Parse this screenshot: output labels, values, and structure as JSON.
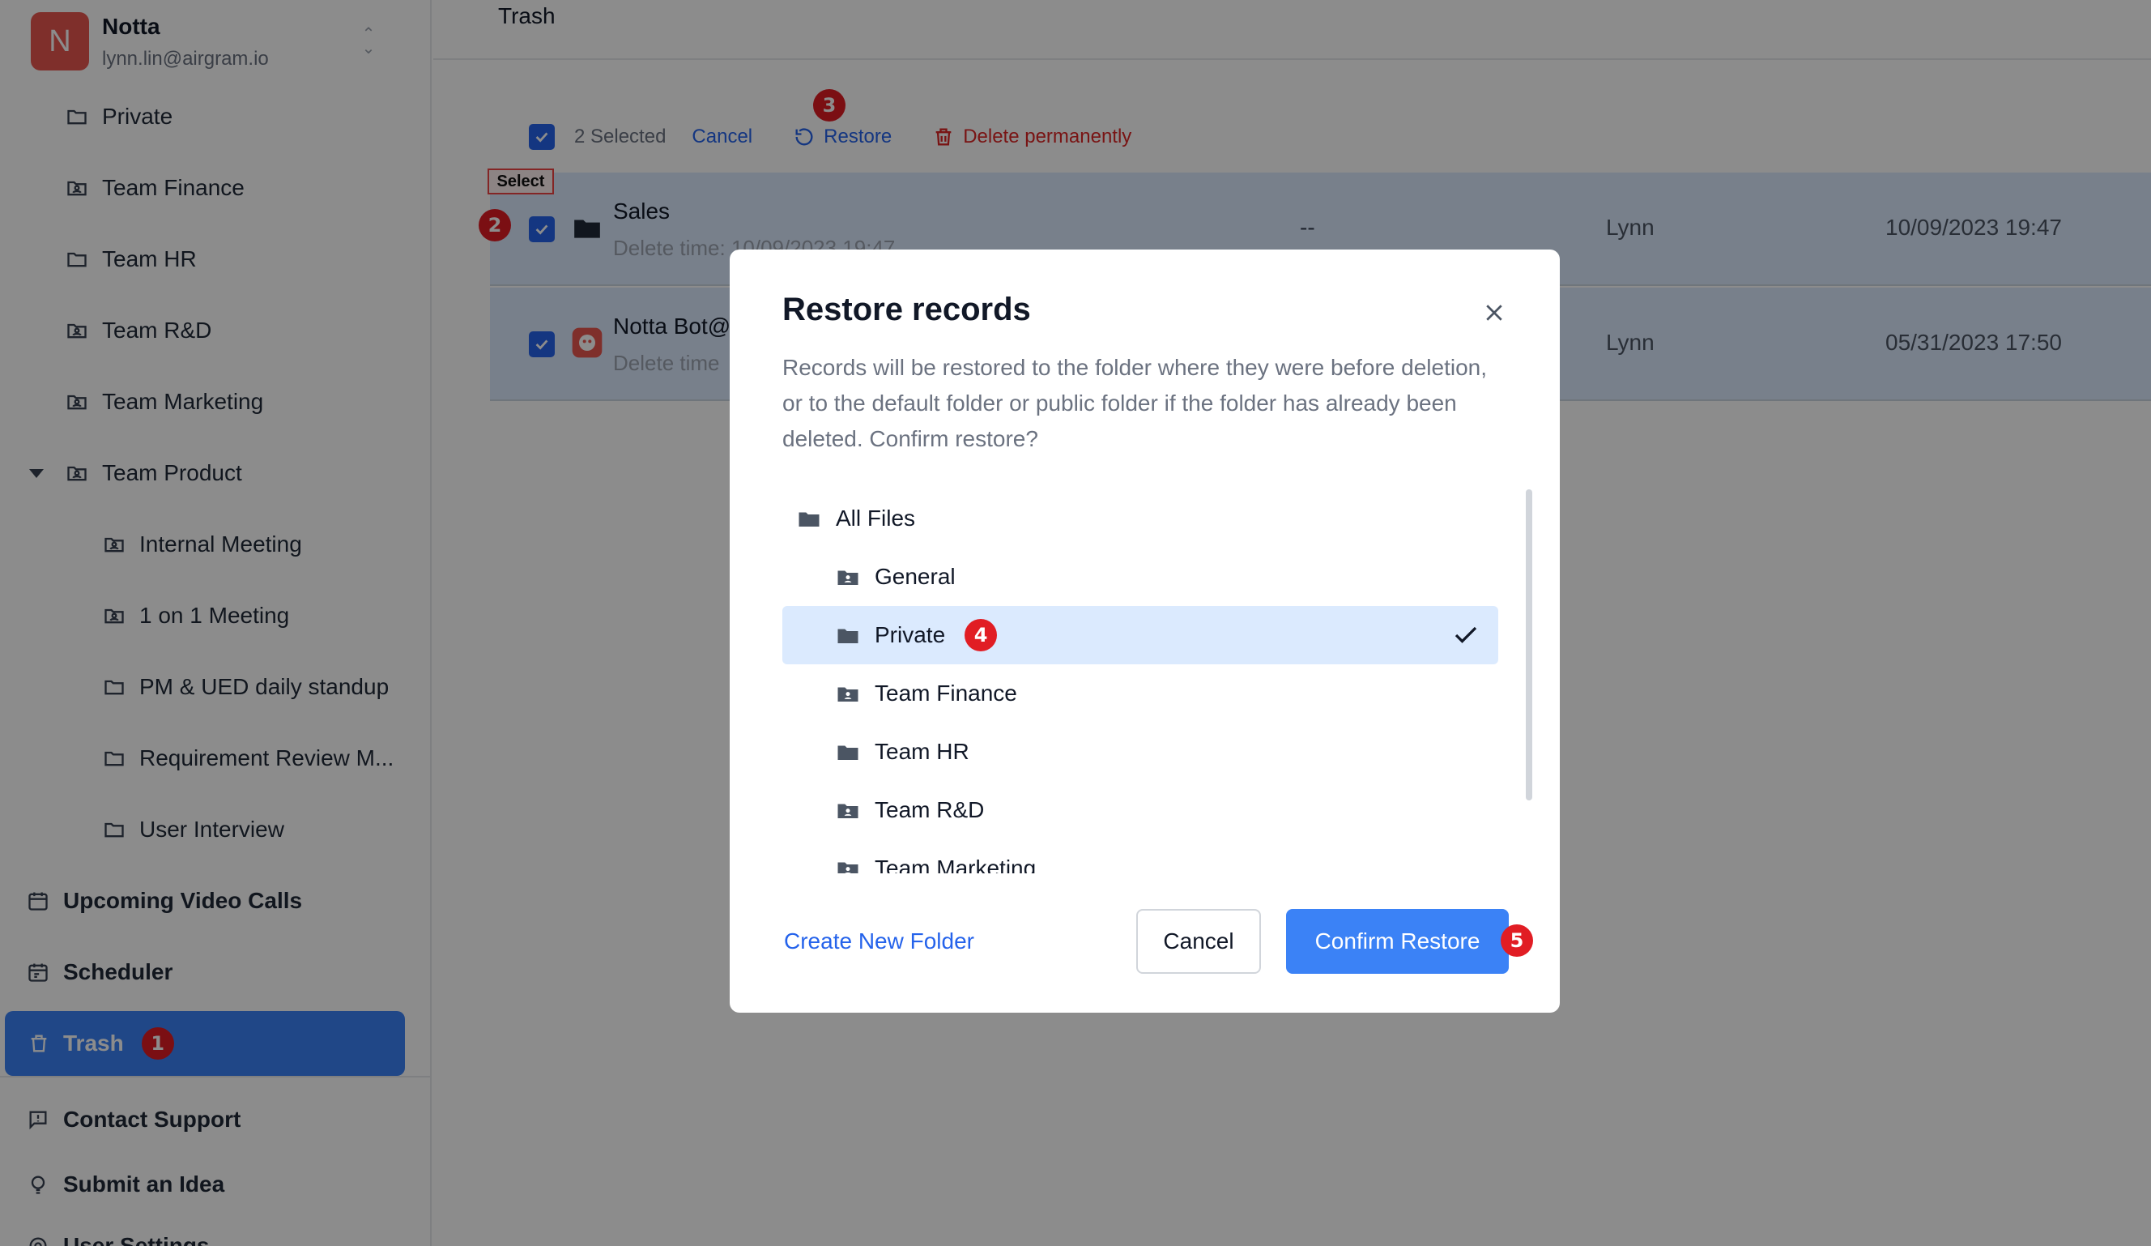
{
  "workspace": {
    "initial": "N",
    "name": "Notta",
    "email": "lynn.lin@airgram.io",
    "switch_icon": "chevron-up-down-icon"
  },
  "sidebar": {
    "folders": [
      {
        "label": "Private",
        "icon": "folder-icon"
      },
      {
        "label": "Team Finance",
        "icon": "team-folder-icon"
      },
      {
        "label": "Team HR",
        "icon": "folder-icon"
      },
      {
        "label": "Team R&D",
        "icon": "team-folder-icon"
      },
      {
        "label": "Team Marketing",
        "icon": "team-folder-icon"
      },
      {
        "label": "Team Product",
        "icon": "team-folder-icon",
        "expanded": true
      }
    ],
    "subfolders": [
      {
        "label": "Internal Meeting",
        "icon": "team-folder-icon"
      },
      {
        "label": "1 on 1 Meeting",
        "icon": "team-folder-icon"
      },
      {
        "label": "PM & UED daily standup",
        "icon": "folder-icon"
      },
      {
        "label": "Requirement Review M...",
        "icon": "folder-icon"
      },
      {
        "label": "User Interview",
        "icon": "folder-icon"
      }
    ],
    "nav": [
      {
        "label": "Upcoming Video Calls",
        "icon": "calendar-icon"
      },
      {
        "label": "Scheduler",
        "icon": "scheduler-icon"
      }
    ],
    "trash": {
      "label": "Trash",
      "icon": "trash-icon",
      "badge": "1"
    },
    "bottom": [
      {
        "label": "Contact Support",
        "icon": "support-icon"
      },
      {
        "label": "Submit an Idea",
        "icon": "lightbulb-icon"
      },
      {
        "label": "User Settings",
        "icon": "settings-icon"
      }
    ]
  },
  "main": {
    "title": "Trash",
    "selection": {
      "count_label": "2 Selected",
      "cancel_label": "Cancel",
      "restore_label": "Restore",
      "restore_badge": "3",
      "delete_label": "Delete permanently",
      "select_tag": "Select",
      "select_badge": "2"
    },
    "rows": [
      {
        "title": "Sales",
        "subtitle": "Delete time: 10/09/2023 19:47",
        "duration": "--",
        "owner": "Lynn",
        "date": "10/09/2023 19:47",
        "icon": "folder-icon",
        "checked": true
      },
      {
        "title": "Notta Bot@",
        "subtitle": "Delete time",
        "duration": "",
        "owner": "Lynn",
        "date": "05/31/2023 17:50",
        "icon": "bot-icon",
        "checked": true
      }
    ]
  },
  "dialog": {
    "title": "Restore records",
    "description": "Records will be restored to the folder where they were before deletion, or to the default folder or public folder if the folder has already been deleted. Confirm restore?",
    "tree": [
      {
        "label": "All Files",
        "icon": "folder-icon",
        "level": 0,
        "selected": false
      },
      {
        "label": "General",
        "icon": "team-folder-icon",
        "level": 1,
        "selected": false
      },
      {
        "label": "Private",
        "icon": "folder-icon",
        "level": 1,
        "selected": true,
        "badge": "4"
      },
      {
        "label": "Team Finance",
        "icon": "team-folder-icon",
        "level": 1,
        "selected": false
      },
      {
        "label": "Team HR",
        "icon": "folder-icon",
        "level": 1,
        "selected": false
      },
      {
        "label": "Team R&D",
        "icon": "team-folder-icon",
        "level": 1,
        "selected": false
      },
      {
        "label": "Team Marketing",
        "icon": "team-folder-icon",
        "level": 1,
        "selected": false
      }
    ],
    "create_label": "Create New Folder",
    "cancel_label": "Cancel",
    "confirm_label": "Confirm Restore",
    "confirm_badge": "5"
  },
  "colors": {
    "accent": "#3b82f6",
    "danger": "#dc2626",
    "badge": "#e11d24",
    "avatar": "#e8574f",
    "selected_row": "#dbeafe"
  }
}
